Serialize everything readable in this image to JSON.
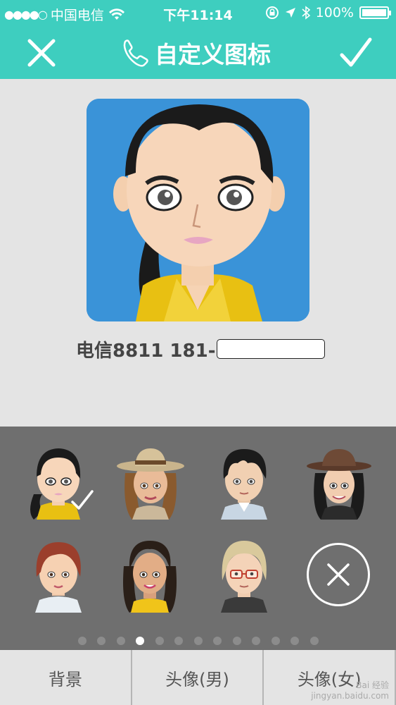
{
  "status": {
    "carrier": "中国电信",
    "time": "下午11:14",
    "battery": "100%",
    "signal_dots": "●●●●○",
    "icons": [
      "wifi-icon",
      "rotation-lock-icon",
      "location-arrow-icon",
      "bluetooth-icon",
      "battery-icon"
    ]
  },
  "nav": {
    "title": "自定义图标",
    "icons": [
      "close-icon",
      "phone-icon",
      "checkmark-icon"
    ]
  },
  "contact": {
    "label": "电信8811 181-"
  },
  "avatars": [
    {
      "name": "woman-ponytail-yellow-jacket",
      "selected": true
    },
    {
      "name": "woman-straw-hat"
    },
    {
      "name": "man-black-hair-shirt"
    },
    {
      "name": "woman-brown-hat"
    },
    {
      "name": "woman-short-red-hair"
    },
    {
      "name": "woman-long-hair-yellow-top"
    },
    {
      "name": "woman-blonde-glasses"
    }
  ],
  "pager": {
    "total": 13,
    "active_index": 3
  },
  "tabs": [
    {
      "label": "背景"
    },
    {
      "label": "头像(男)"
    },
    {
      "label": "头像(女)",
      "active": true
    }
  ],
  "watermark": {
    "line1": "Bai 经验",
    "line2": "jingyan.baidu.com"
  },
  "colors": {
    "accent": "#3ecebf",
    "preview_bg": "#3a93d8",
    "picker_bg": "#6f6f6f",
    "page_bg": "#e4e4e4"
  }
}
